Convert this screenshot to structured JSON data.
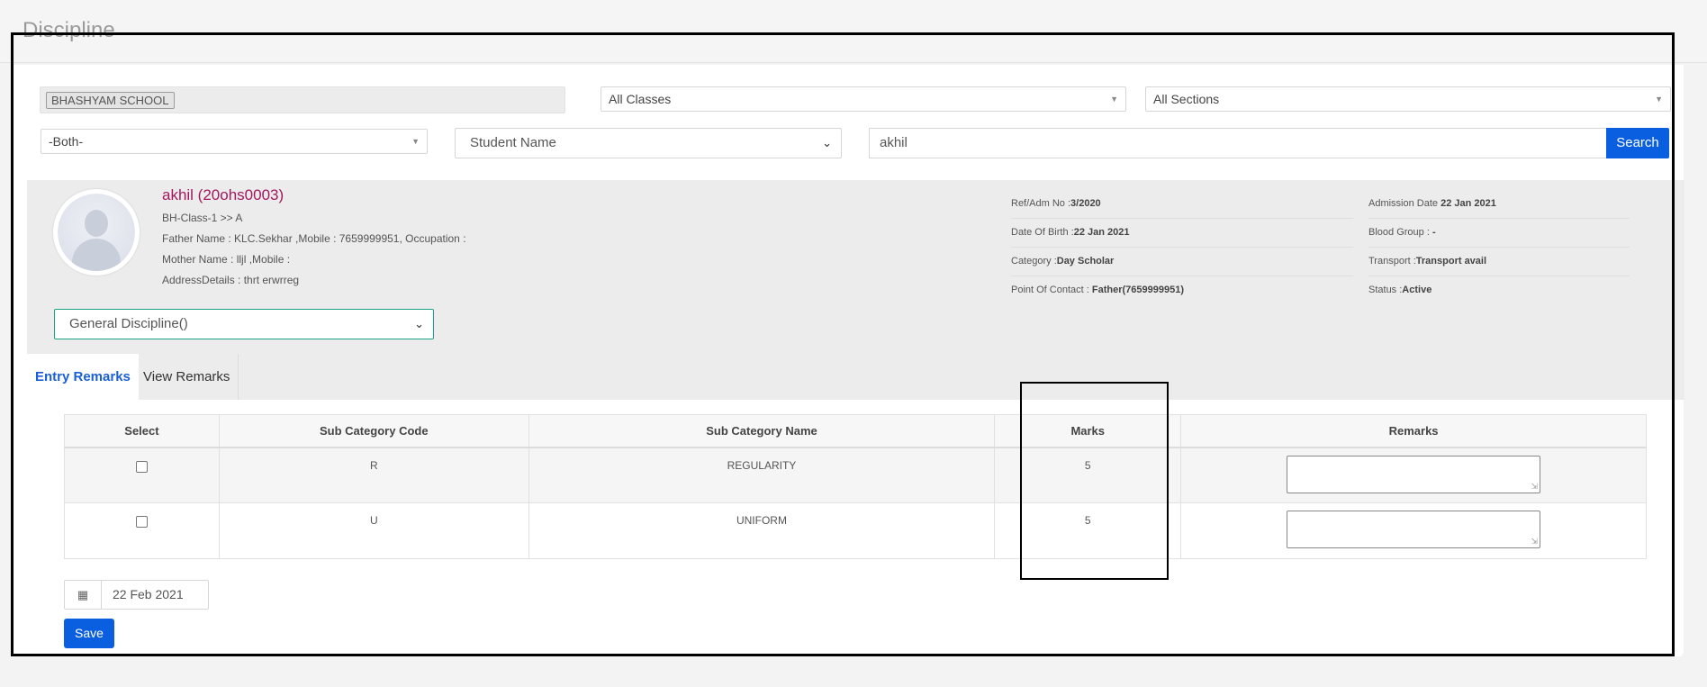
{
  "page": {
    "title": "Discipline"
  },
  "filters": {
    "school": "BHASHYAM SCHOOL",
    "classes": "All Classes",
    "sections": "All Sections",
    "gender": "-Both-",
    "search_by": "Student Name",
    "search_value": "akhil",
    "search_button": "Search"
  },
  "student": {
    "name": "akhil (20ohs0003)",
    "class": "BH-Class-1 >> A",
    "father": "Father Name : KLC.Sekhar ,Mobile : 7659999951, Occupation :",
    "mother": "Mother Name : lljl ,Mobile :",
    "address": "AddressDetails : thrt erwrreg",
    "ref_label": "Ref/Adm No :",
    "ref_value": "3/2020",
    "dob_label": "Date Of Birth :",
    "dob_value": "22 Jan 2021",
    "category_label": "Category :",
    "category_value": "Day Scholar",
    "contact_label": "Point Of Contact :",
    "contact_value": "Father(7659999951)",
    "admission_label": "Admission Date",
    "admission_value": "22 Jan 2021",
    "blood_label": "Blood Group :",
    "blood_value": "-",
    "transport_label": "Transport :",
    "transport_value": "Transport avail",
    "status_label": "Status :",
    "status_value": "Active"
  },
  "discipline_select": "General Discipline()",
  "tabs": [
    {
      "label": "Entry Remarks",
      "active": true
    },
    {
      "label": "View Remarks",
      "active": false
    }
  ],
  "table": {
    "headers": [
      "Select",
      "Sub Category Code",
      "Sub Category Name",
      "Marks",
      "Remarks"
    ],
    "rows": [
      {
        "code": "R",
        "name": "REGULARITY",
        "marks": "5"
      },
      {
        "code": "U",
        "name": "UNIFORM",
        "marks": "5"
      }
    ]
  },
  "date": "22 Feb 2021",
  "save_button": "Save",
  "colors": {
    "accent": "#0a5fe0",
    "student_name": "#a3185f",
    "select_border": "#1aa386"
  }
}
